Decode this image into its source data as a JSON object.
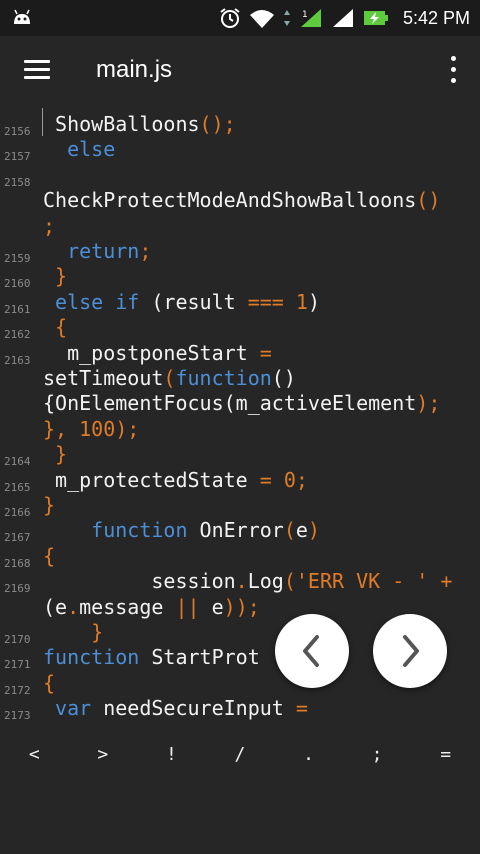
{
  "status_bar": {
    "time": "5:42 PM",
    "icons": [
      "android-icon",
      "alarm-icon",
      "wifi-icon",
      "signal-icon",
      "signal-icon-2",
      "battery-charging-icon"
    ]
  },
  "app_bar": {
    "title": "main.js",
    "menu_icon": "hamburger-icon",
    "overflow_icon": "more-vert-icon"
  },
  "lines": [
    {
      "n": "2156",
      "rows": [
        [
          [
            " ShowBalloons",
            ""
          ],
          [
            "();",
            "p"
          ]
        ]
      ]
    },
    {
      "n": "2157",
      "rows": [
        [
          [
            "  else",
            "kw"
          ]
        ]
      ]
    },
    {
      "n": "2158",
      "rows": [
        [
          [
            "",
            ""
          ]
        ],
        [
          [
            "CheckProtectModeAndShowBalloons",
            ""
          ],
          [
            "()",
            "p"
          ]
        ],
        [
          [
            ";",
            "p"
          ]
        ]
      ]
    },
    {
      "n": "2159",
      "rows": [
        [
          [
            "  ",
            ""
          ],
          [
            "return",
            "kw"
          ],
          [
            ";",
            "p"
          ]
        ]
      ]
    },
    {
      "n": "2160",
      "rows": [
        [
          [
            " }",
            "p"
          ]
        ]
      ]
    },
    {
      "n": "2161",
      "rows": [
        [
          [
            " ",
            ""
          ],
          [
            "else if",
            "kw"
          ],
          [
            " (result ",
            ""
          ],
          [
            "===",
            "p"
          ],
          [
            " ",
            ""
          ],
          [
            "1",
            "p"
          ],
          [
            ")",
            ""
          ]
        ]
      ]
    },
    {
      "n": "2162",
      "rows": [
        [
          [
            " {",
            "p"
          ]
        ]
      ]
    },
    {
      "n": "2163",
      "rows": [
        [
          [
            "  m_postponeStart ",
            ""
          ],
          [
            "=",
            "p"
          ]
        ],
        [
          [
            "setTimeout",
            ""
          ],
          [
            "(",
            "p"
          ],
          [
            "function",
            "kw"
          ],
          [
            "()",
            ""
          ]
        ],
        [
          [
            "{",
            ""
          ],
          [
            "OnElementFocus",
            ""
          ],
          [
            "(",
            ""
          ],
          [
            "m_activeElement",
            ""
          ],
          [
            ");",
            "p"
          ]
        ],
        [
          [
            "}, ",
            "p"
          ],
          [
            "100",
            "p"
          ],
          [
            ");",
            "p"
          ]
        ]
      ]
    },
    {
      "n": "2164",
      "rows": [
        [
          [
            " }",
            "p"
          ]
        ]
      ]
    },
    {
      "n": "2165",
      "rows": [
        [
          [
            " m_protectedState ",
            ""
          ],
          [
            "=",
            "p"
          ],
          [
            " ",
            ""
          ],
          [
            "0",
            "p"
          ],
          [
            ";",
            "p"
          ]
        ]
      ]
    },
    {
      "n": "2166",
      "rows": [
        [
          [
            "}",
            "p"
          ]
        ]
      ]
    },
    {
      "n": "2167",
      "rows": [
        [
          [
            "    ",
            ""
          ],
          [
            "function",
            "kw"
          ],
          [
            " OnError",
            ""
          ],
          [
            "(",
            "p"
          ],
          [
            "e",
            ""
          ],
          [
            ")",
            "p"
          ]
        ]
      ]
    },
    {
      "n": "2168",
      "rows": [
        [
          [
            "{",
            "p"
          ]
        ]
      ]
    },
    {
      "n": "2169",
      "rows": [
        [
          [
            "         session",
            ""
          ],
          [
            ".",
            "p"
          ],
          [
            "Log",
            ""
          ],
          [
            "(",
            "p"
          ],
          [
            "'ERR VK - '",
            "p"
          ],
          [
            " ",
            ""
          ],
          [
            "+",
            "p"
          ]
        ],
        [
          [
            "(",
            ""
          ],
          [
            "e",
            ""
          ],
          [
            ".",
            "p"
          ],
          [
            "message ",
            ""
          ],
          [
            "||",
            "p"
          ],
          [
            " e",
            ""
          ],
          [
            "));",
            "p"
          ]
        ]
      ]
    },
    {
      "n": "2170",
      "rows": [
        [
          [
            "    }",
            "p"
          ]
        ]
      ]
    },
    {
      "n": "2171",
      "rows": [
        [
          [
            "function",
            "kw"
          ],
          [
            " StartProt",
            ""
          ]
        ]
      ]
    },
    {
      "n": "2172",
      "rows": [
        [
          [
            "{",
            "p"
          ]
        ]
      ]
    },
    {
      "n": "2173",
      "rows": [
        [
          [
            " ",
            ""
          ],
          [
            "var",
            "kw"
          ],
          [
            " needSecureInput ",
            ""
          ],
          [
            "=",
            "p"
          ]
        ]
      ]
    }
  ],
  "nav": {
    "prev_icon": "chevron-left-icon",
    "next_icon": "chevron-right-icon"
  },
  "symbols": [
    "<",
    ">",
    "!",
    "/",
    ".",
    ";",
    "="
  ]
}
